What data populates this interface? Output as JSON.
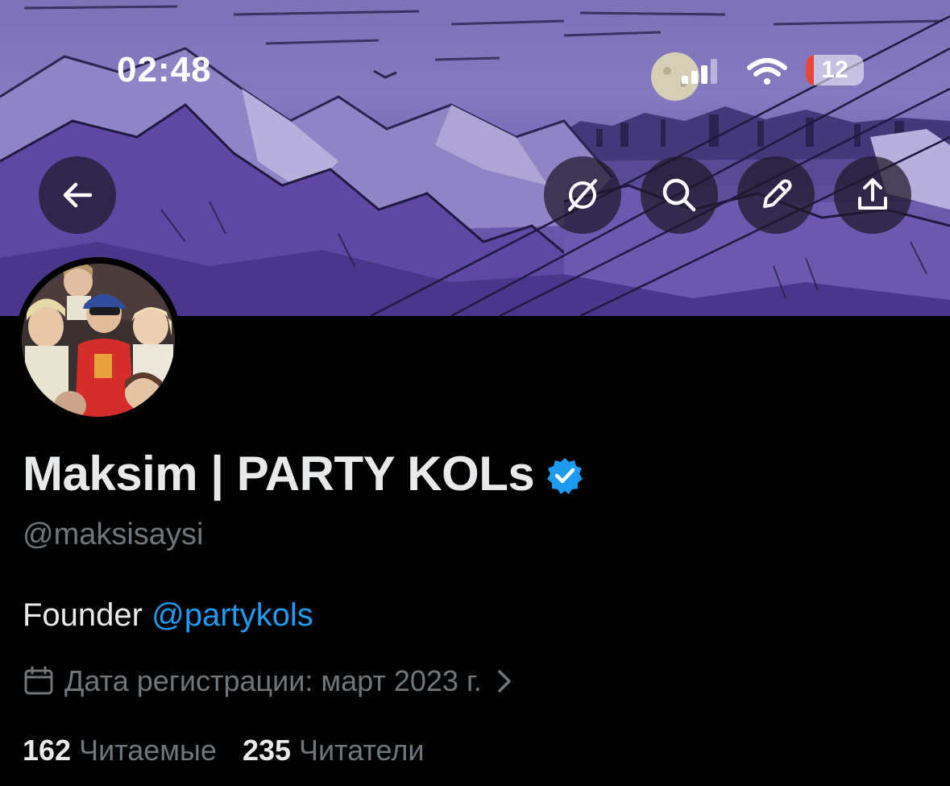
{
  "status_bar": {
    "time": "02:48",
    "battery_level": "12",
    "icons": [
      "cellular-signal-icon",
      "wifi-icon",
      "battery-icon"
    ]
  },
  "header_buttons": {
    "back": "arrow-left-icon",
    "actions": [
      "grok-icon",
      "search-icon",
      "edit-pencil-icon",
      "share-upload-icon"
    ]
  },
  "profile": {
    "name": "Maksim | PARTY KOLs",
    "verified": true,
    "handle": "@maksisaysi",
    "bio_text": "Founder ",
    "bio_mention": "@partykols",
    "joined": "Дата регистрации: март 2023 г.",
    "following_count": "162",
    "following_label": "Читаемые",
    "followers_count": "235",
    "followers_label": "Читатели"
  },
  "colors": {
    "background": "#000000",
    "text_primary": "#e7e9ea",
    "text_secondary": "#71767b",
    "accent": "#1d9bf0",
    "banner_purple": "#7d72b8"
  }
}
